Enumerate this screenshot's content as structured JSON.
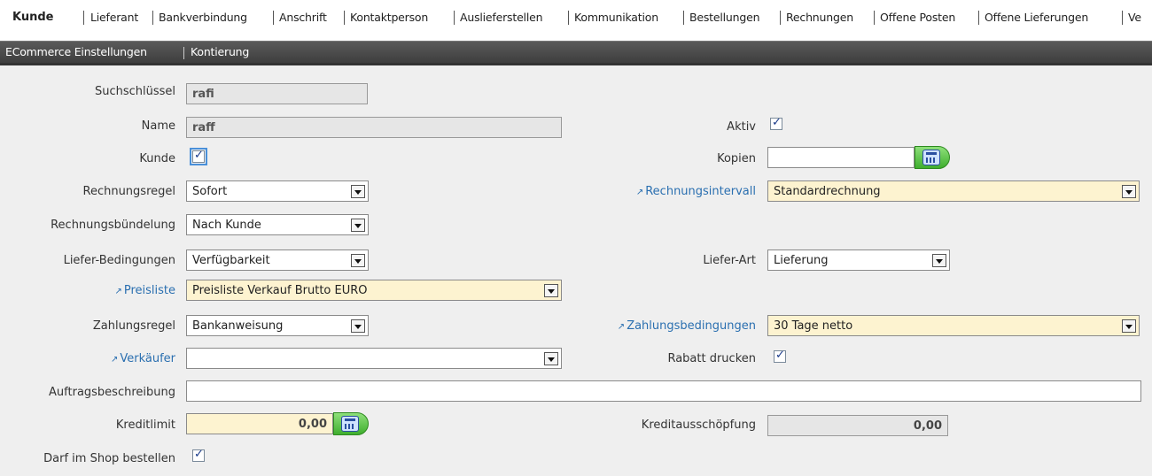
{
  "tabs_top": {
    "active": "Kunde",
    "items": [
      "Lieferant",
      "Bankverbindung",
      "Anschrift",
      "Kontaktperson",
      "Auslieferstellen",
      "Kommunikation",
      "Bestellungen",
      "Rechnungen",
      "Offene Posten",
      "Offene Lieferungen",
      "Ve"
    ]
  },
  "tabs_bottom": {
    "items": [
      "ECommerce Einstellungen",
      "Kontierung"
    ]
  },
  "form": {
    "suchschluessel": {
      "label": "Suchschlüssel",
      "value": "rafi"
    },
    "name": {
      "label": "Name",
      "value": "raff"
    },
    "aktiv": {
      "label": "Aktiv",
      "checked": true
    },
    "kunde": {
      "label": "Kunde",
      "checked": true
    },
    "kopien": {
      "label": "Kopien",
      "value": ""
    },
    "rechnungsregel": {
      "label": "Rechnungsregel",
      "value": "Sofort"
    },
    "rechnungsintervall": {
      "label": "Rechnungsintervall",
      "value": "Standardrechnung"
    },
    "rechnungsbuendelung": {
      "label": "Rechnungsbündelung",
      "value": "Nach Kunde"
    },
    "liefer_bedingungen": {
      "label": "Liefer-Bedingungen",
      "value": "Verfügbarkeit"
    },
    "liefer_art": {
      "label": "Liefer-Art",
      "value": "Lieferung"
    },
    "preisliste": {
      "label": "Preisliste",
      "value": "Preisliste Verkauf Brutto EURO"
    },
    "zahlungsregel": {
      "label": "Zahlungsregel",
      "value": "Bankanweisung"
    },
    "zahlungsbedingungen": {
      "label": "Zahlungsbedingungen",
      "value": "30 Tage netto"
    },
    "verkaeufer": {
      "label": "Verkäufer",
      "value": ""
    },
    "rabatt_drucken": {
      "label": "Rabatt drucken",
      "checked": true
    },
    "auftragsbeschreibung": {
      "label": "Auftragsbeschreibung",
      "value": ""
    },
    "kreditlimit": {
      "label": "Kreditlimit",
      "value": "0,00"
    },
    "kreditausschoepfung": {
      "label": "Kreditausschöpfung",
      "value": "0,00"
    },
    "darf_im_shop": {
      "label": "Darf im Shop bestellen",
      "checked": true
    }
  },
  "colors": {
    "link": "#2a6fb0",
    "highlight_field": "#fdf3d0",
    "tab_bar_dark": "#3e3e3e"
  }
}
